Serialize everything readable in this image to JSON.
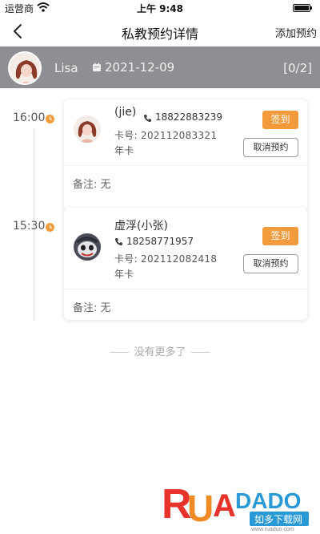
{
  "status_bar": {
    "carrier": "运营商",
    "time": "上午 9:48"
  },
  "nav": {
    "title": "私教预约详情",
    "action": "添加预约"
  },
  "coach": {
    "name": "Lisa",
    "date": "2021-12-09",
    "count": "[0/2]"
  },
  "bookings": [
    {
      "time": "16:00",
      "member_name": "(jie)",
      "phone": "18822883239",
      "card_number": "卡号:  202112083321",
      "card_type": "年卡",
      "checkin_label": "签到",
      "cancel_label": "取消预约",
      "note": "备注: 无"
    },
    {
      "time": "15:30",
      "member_name": "虚浮(小张)",
      "phone": "18258771957",
      "card_number": "卡号:  202112082418",
      "card_type": "年卡",
      "checkin_label": "签到",
      "cancel_label": "取消预约",
      "note": "备注: 无"
    }
  ],
  "footer": {
    "end_text": "没有更多了"
  },
  "watermark": {
    "brand": "RUADADO",
    "site_cn": "如多下载网",
    "site": "www.ruaduo.com"
  },
  "colors": {
    "accent": "#f39b3c",
    "header_bar": "#8e8e93"
  },
  "icons": [
    "wifi-icon",
    "battery-icon",
    "back-arrow-icon",
    "calendar-icon",
    "clock-icon",
    "phone-icon"
  ]
}
